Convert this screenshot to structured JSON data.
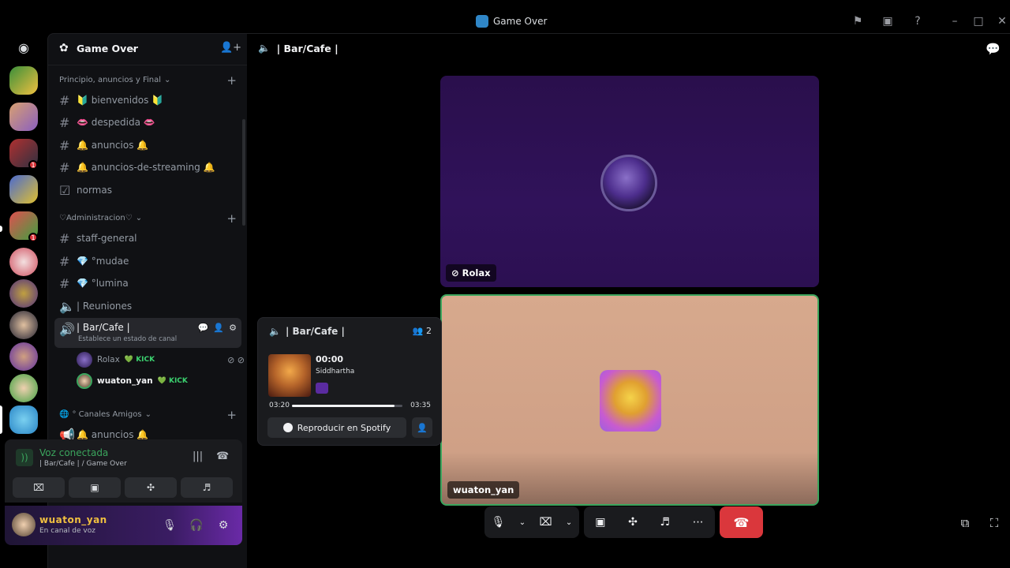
{
  "window": {
    "title": "Game Over",
    "controls": [
      "flag-icon",
      "screen-icon",
      "help-icon",
      "minimize-icon",
      "maximize-icon",
      "close-icon"
    ]
  },
  "server": {
    "name": "Game Over",
    "rail_badges": [
      "1",
      "1"
    ]
  },
  "categories": [
    {
      "name": "Principio, anuncios y Final",
      "channels": [
        {
          "type": "text",
          "label": "🔰 bienvenidos 🔰"
        },
        {
          "type": "text",
          "label": "👄 despedida 👄"
        },
        {
          "type": "text",
          "label": "🔔 anuncios 🔔"
        },
        {
          "type": "text",
          "label": "🔔 anuncios-de-streaming 🔔"
        },
        {
          "type": "rules",
          "label": "normas"
        }
      ]
    },
    {
      "name": "♡Administracion♡",
      "channels": [
        {
          "type": "text",
          "label": "staff-general"
        },
        {
          "type": "text",
          "label": "💎 °mudae"
        },
        {
          "type": "text",
          "label": "💎 °lumina"
        },
        {
          "type": "voice",
          "label": "| Reuniones"
        },
        {
          "type": "voice",
          "label": "| Bar/Cafe |",
          "active": true,
          "status": "Establece un estado de canal"
        }
      ]
    },
    {
      "name": "° Canales Amigos",
      "channels": [
        {
          "type": "announce",
          "label": "🔔 anuncios 🔔"
        }
      ]
    }
  ],
  "voice_users": [
    {
      "name": "Rolax",
      "tag": "KICK"
    },
    {
      "name": "wuaton_yan",
      "tag": "KICK"
    }
  ],
  "voice_panel": {
    "title": "Voz conectada",
    "sub": "| Bar/Cafe | / Game Over"
  },
  "user_panel": {
    "name": "wuaton_yan",
    "status": "En canal de voz"
  },
  "main": {
    "header": "| Bar/Cafe |",
    "tiles": [
      {
        "name": "Rolax"
      },
      {
        "name": "wuaton_yan",
        "speaking": true
      }
    ]
  },
  "popup": {
    "channel": "| Bar/Cafe |",
    "count": "2",
    "time": "00:00",
    "artist": "Siddhartha",
    "elapsed": "03:20",
    "duration": "03:35",
    "progress": 0.93,
    "spotify_label": "Reproducir en Spotify"
  },
  "colors": {
    "accent_green": "#3ba55d",
    "hangup_red": "#da373c",
    "tile1_bg": "#2a0f4c",
    "tile2_bg": "#d7a98d"
  }
}
